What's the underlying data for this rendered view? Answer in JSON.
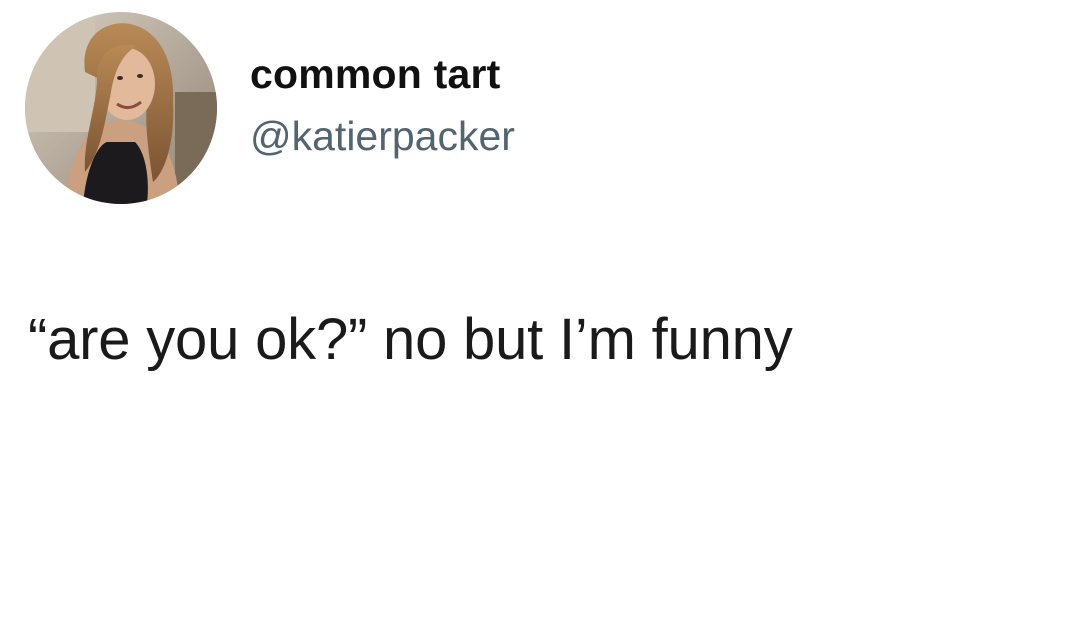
{
  "author": {
    "display_name": "common tart",
    "handle": "@katierpacker",
    "avatar_icon": "profile-photo-avatar"
  },
  "tweet": {
    "text": "“are you ok?” no but I’m funny"
  },
  "colors": {
    "background": "#ffffff",
    "text": "#1a1a1a",
    "handle": "#536471"
  }
}
